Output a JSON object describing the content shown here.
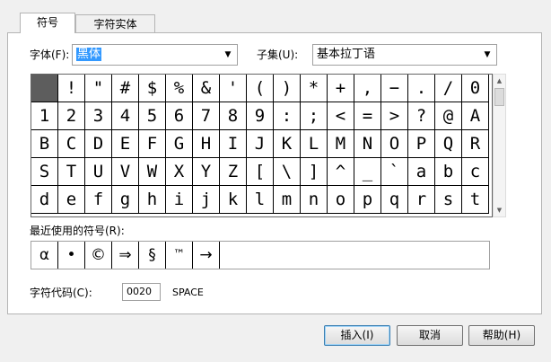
{
  "tabs": [
    "符号",
    "字符实体"
  ],
  "font": {
    "label": "字体(F):",
    "value": "黑体"
  },
  "subset": {
    "label": "子集(U):",
    "value": "基本拉丁语"
  },
  "symbols": [
    [
      " ",
      "!",
      "\"",
      "#",
      "$",
      "%",
      "&",
      "'",
      "(",
      ")",
      "*",
      "+",
      ",",
      "−",
      ".",
      "/",
      "0"
    ],
    [
      "1",
      "2",
      "3",
      "4",
      "5",
      "6",
      "7",
      "8",
      "9",
      ":",
      ";",
      "<",
      "=",
      ">",
      "?",
      "@",
      "A"
    ],
    [
      "B",
      "C",
      "D",
      "E",
      "F",
      "G",
      "H",
      "I",
      "J",
      "K",
      "L",
      "M",
      "N",
      "O",
      "P",
      "Q",
      "R"
    ],
    [
      "S",
      "T",
      "U",
      "V",
      "W",
      "X",
      "Y",
      "Z",
      "[",
      "\\",
      "]",
      "^",
      "_",
      "`",
      "a",
      "b",
      "c"
    ],
    [
      "d",
      "e",
      "f",
      "g",
      "h",
      "i",
      "j",
      "k",
      "l",
      "m",
      "n",
      "o",
      "p",
      "q",
      "r",
      "s",
      "t"
    ]
  ],
  "recent": {
    "label": "最近使用的符号(R):",
    "items": [
      "α",
      "•",
      "©",
      "⇒",
      "§",
      "™",
      "→"
    ]
  },
  "charcode": {
    "label": "字符代码(C):",
    "value": "0020",
    "name": "SPACE"
  },
  "buttons": {
    "insert": "插入(I)",
    "cancel": "取消",
    "help": "帮助(H)"
  }
}
